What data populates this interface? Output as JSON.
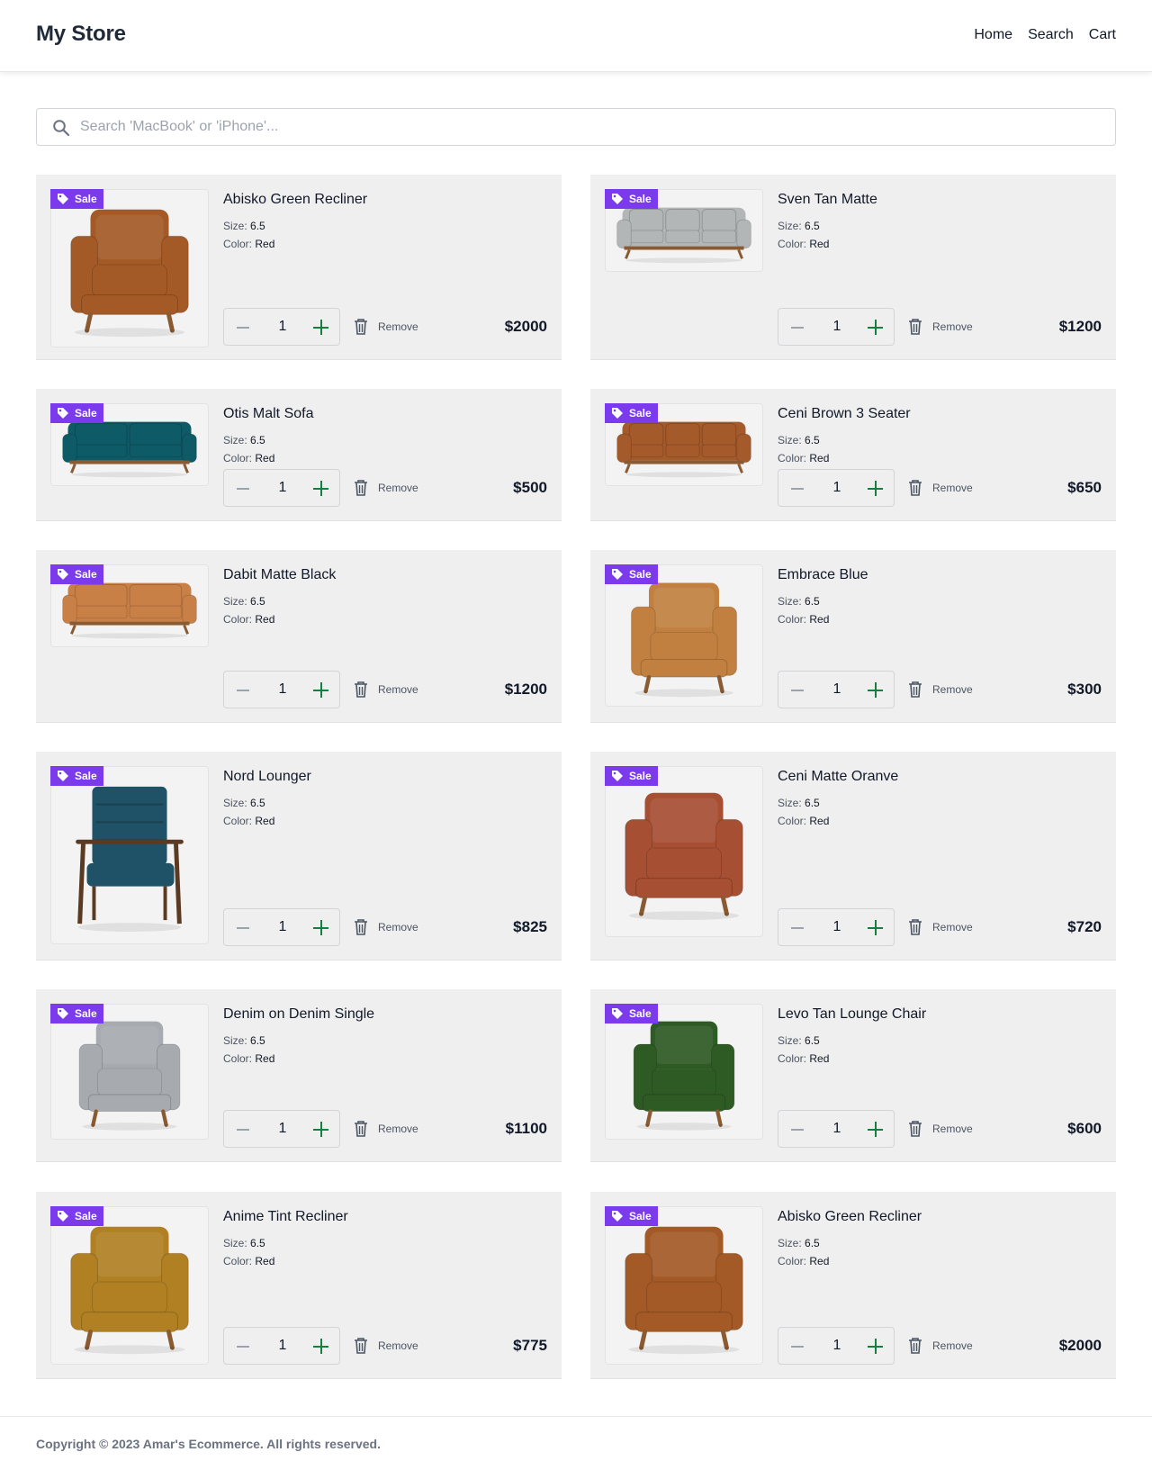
{
  "header": {
    "brand": "My Store",
    "nav": [
      "Home",
      "Search",
      "Cart"
    ]
  },
  "search": {
    "placeholder": "Search 'MacBook' or 'iPhone'..."
  },
  "labels": {
    "sale": "Sale",
    "size_label": "Size:",
    "color_label": "Color:",
    "remove": "Remove"
  },
  "items": [
    {
      "name": "Abisko Green Recliner",
      "size": "6.5",
      "color": "Red",
      "qty": "1",
      "price": "$2000",
      "image": "armchair",
      "tint": "#a45a26"
    },
    {
      "name": "Sven Tan Matte",
      "size": "6.5",
      "color": "Red",
      "qty": "1",
      "price": "$1200",
      "image": "sofa-3",
      "tint": "#b3b6b6"
    },
    {
      "name": "Otis Malt Sofa",
      "size": "6.5",
      "color": "Red",
      "qty": "1",
      "price": "$500",
      "image": "sofa-2",
      "tint": "#0e5a66"
    },
    {
      "name": "Ceni Brown 3 Seater",
      "size": "6.5",
      "color": "Red",
      "qty": "1",
      "price": "$650",
      "image": "sofa-3",
      "tint": "#a45a2a"
    },
    {
      "name": "Dabit Matte Black",
      "size": "6.5",
      "color": "Red",
      "qty": "1",
      "price": "$1200",
      "image": "sofa-2",
      "tint": "#c98047"
    },
    {
      "name": "Embrace Blue",
      "size": "6.5",
      "color": "Red",
      "qty": "1",
      "price": "$300",
      "image": "armchair",
      "tint": "#c1803f"
    },
    {
      "name": "Nord Lounger",
      "size": "6.5",
      "color": "Red",
      "qty": "1",
      "price": "$825",
      "image": "lounger",
      "tint": "#1f5266"
    },
    {
      "name": "Ceni Matte Oranve",
      "size": "6.5",
      "color": "Red",
      "qty": "1",
      "price": "$720",
      "image": "armchair",
      "tint": "#a64f33"
    },
    {
      "name": "Denim on Denim Single",
      "size": "6.5",
      "color": "Red",
      "qty": "1",
      "price": "$1100",
      "image": "armchair",
      "tint": "#a7abaf"
    },
    {
      "name": "Levo Tan Lounge Chair",
      "size": "6.5",
      "color": "Red",
      "qty": "1",
      "price": "$600",
      "image": "armchair",
      "tint": "#2e5a24"
    },
    {
      "name": "Anime Tint Recliner",
      "size": "6.5",
      "color": "Red",
      "qty": "1",
      "price": "$775",
      "image": "armchair",
      "tint": "#b08023"
    },
    {
      "name": "Abisko Green Recliner",
      "size": "6.5",
      "color": "Red",
      "qty": "1",
      "price": "$2000",
      "image": "armchair",
      "tint": "#a45a26"
    }
  ],
  "footer": {
    "copyright": "Copyright © 2023 Amar's Ecommerce. All rights reserved."
  },
  "colors": {
    "sale_badge": "#7c3aed",
    "plus": "#15803d",
    "card_bg": "#efefef"
  }
}
